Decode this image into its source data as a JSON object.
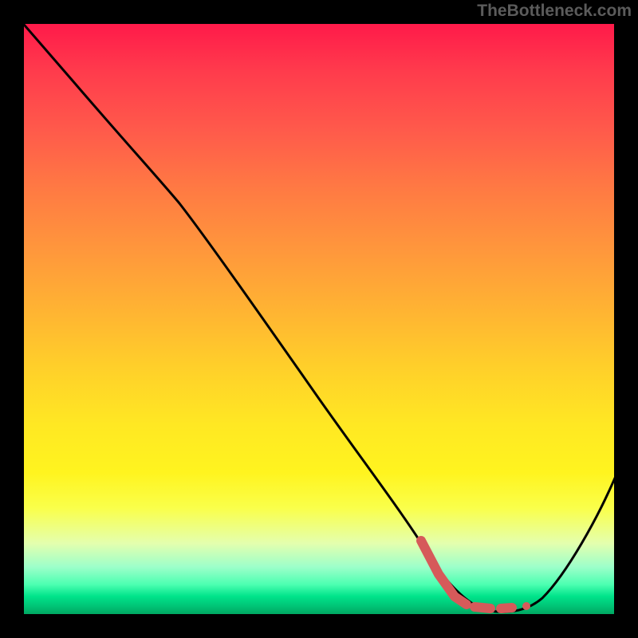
{
  "watermark": "TheBottleneck.com",
  "chart_data": {
    "type": "line",
    "title": "",
    "xlabel": "",
    "ylabel": "",
    "xlim": [
      0,
      100
    ],
    "ylim": [
      0,
      100
    ],
    "series": [
      {
        "name": "bottleneck-curve",
        "color": "#000000",
        "x": [
          0,
          10,
          20,
          30,
          40,
          50,
          60,
          65,
          70,
          74,
          78,
          82,
          86,
          90,
          95,
          100
        ],
        "y": [
          100,
          90,
          80,
          73,
          62,
          50,
          38,
          30,
          18,
          6,
          1,
          0,
          0.5,
          2,
          10,
          25
        ]
      },
      {
        "name": "highlight-segment",
        "color": "#d65a5a",
        "style": "dashed-thick",
        "x": [
          65,
          68,
          71,
          74,
          76,
          78,
          80,
          82,
          84
        ],
        "y": [
          22,
          15,
          9,
          4,
          2,
          1,
          0.5,
          0.3,
          0.3
        ]
      }
    ],
    "gradient_stops": [
      {
        "pos": 0,
        "color": "#ff1a4a"
      },
      {
        "pos": 0.5,
        "color": "#ffcf2a"
      },
      {
        "pos": 0.85,
        "color": "#faff4a"
      },
      {
        "pos": 1.0,
        "color": "#00a862"
      }
    ]
  }
}
